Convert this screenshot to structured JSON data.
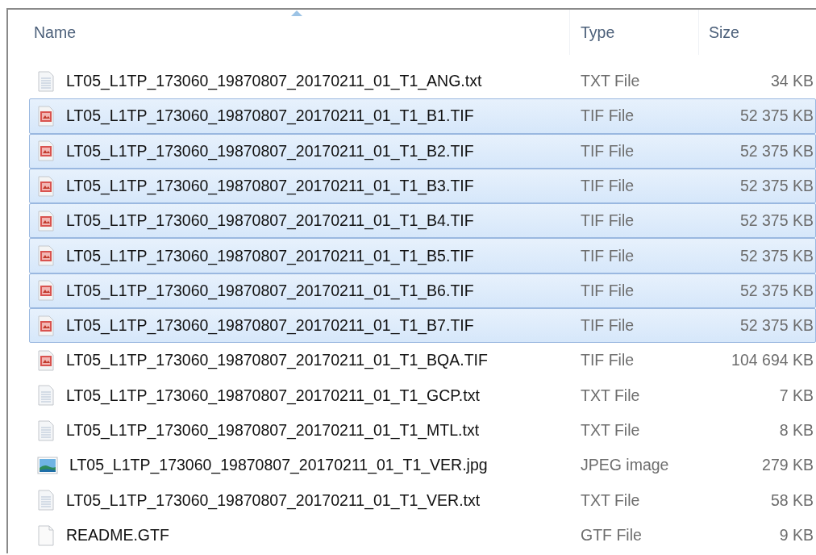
{
  "columns": [
    {
      "label": "Name",
      "sorted": true
    },
    {
      "label": "Type",
      "sorted": false
    },
    {
      "label": "Size",
      "sorted": false
    }
  ],
  "files": [
    {
      "name": "LT05_L1TP_173060_19870807_20170211_01_T1_ANG.txt",
      "type": "TXT File",
      "size": "34 KB",
      "kind": "text",
      "selected": false
    },
    {
      "name": "LT05_L1TP_173060_19870807_20170211_01_T1_B1.TIF",
      "type": "TIF File",
      "size": "52 375 KB",
      "kind": "tif",
      "selected": true
    },
    {
      "name": "LT05_L1TP_173060_19870807_20170211_01_T1_B2.TIF",
      "type": "TIF File",
      "size": "52 375 KB",
      "kind": "tif",
      "selected": true
    },
    {
      "name": "LT05_L1TP_173060_19870807_20170211_01_T1_B3.TIF",
      "type": "TIF File",
      "size": "52 375 KB",
      "kind": "tif",
      "selected": true
    },
    {
      "name": "LT05_L1TP_173060_19870807_20170211_01_T1_B4.TIF",
      "type": "TIF File",
      "size": "52 375 KB",
      "kind": "tif",
      "selected": true
    },
    {
      "name": "LT05_L1TP_173060_19870807_20170211_01_T1_B5.TIF",
      "type": "TIF File",
      "size": "52 375 KB",
      "kind": "tif",
      "selected": true
    },
    {
      "name": "LT05_L1TP_173060_19870807_20170211_01_T1_B6.TIF",
      "type": "TIF File",
      "size": "52 375 KB",
      "kind": "tif",
      "selected": true
    },
    {
      "name": "LT05_L1TP_173060_19870807_20170211_01_T1_B7.TIF",
      "type": "TIF File",
      "size": "52 375 KB",
      "kind": "tif",
      "selected": true
    },
    {
      "name": "LT05_L1TP_173060_19870807_20170211_01_T1_BQA.TIF",
      "type": "TIF File",
      "size": "104 694 KB",
      "kind": "tif",
      "selected": false
    },
    {
      "name": "LT05_L1TP_173060_19870807_20170211_01_T1_GCP.txt",
      "type": "TXT File",
      "size": "7 KB",
      "kind": "text",
      "selected": false
    },
    {
      "name": "LT05_L1TP_173060_19870807_20170211_01_T1_MTL.txt",
      "type": "TXT File",
      "size": "8 KB",
      "kind": "text",
      "selected": false
    },
    {
      "name": "LT05_L1TP_173060_19870807_20170211_01_T1_VER.jpg",
      "type": "JPEG image",
      "size": "279 KB",
      "kind": "image",
      "selected": false
    },
    {
      "name": "LT05_L1TP_173060_19870807_20170211_01_T1_VER.txt",
      "type": "TXT File",
      "size": "58 KB",
      "kind": "text",
      "selected": false
    },
    {
      "name": "README.GTF",
      "type": "GTF File",
      "size": "9 KB",
      "kind": "blank",
      "selected": false
    }
  ]
}
